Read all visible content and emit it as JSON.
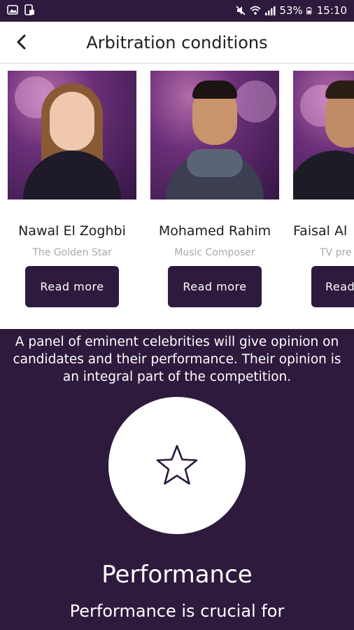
{
  "status_bar": {
    "battery": "53%",
    "time": "15:10",
    "icons": [
      "gallery-icon",
      "screenshot-icon",
      "mute-icon",
      "wifi-icon",
      "signal-icon",
      "battery-icon"
    ]
  },
  "header": {
    "title": "Arbitration conditions",
    "back_icon": "chevron-left-icon"
  },
  "judges": [
    {
      "name": "Nawal El Zoghbi",
      "role": "The Golden Star",
      "button": "Read more"
    },
    {
      "name": "Mohamed Rahim",
      "role": "Music Composer",
      "button": "Read more"
    },
    {
      "name": "Faisal Al",
      "role": "TV pre",
      "button": "Read"
    }
  ],
  "panel": {
    "description": "A panel of eminent celebrities will give opinion on candidates and their performance. Their opinion is an integral part of the competition.",
    "icon": "star-icon",
    "criterion_title": "Performance",
    "criterion_text": "Performance is crucial for"
  },
  "colors": {
    "primary": "#2e1a3d",
    "background": "#ffffff",
    "muted_text": "#a9a9a9"
  }
}
